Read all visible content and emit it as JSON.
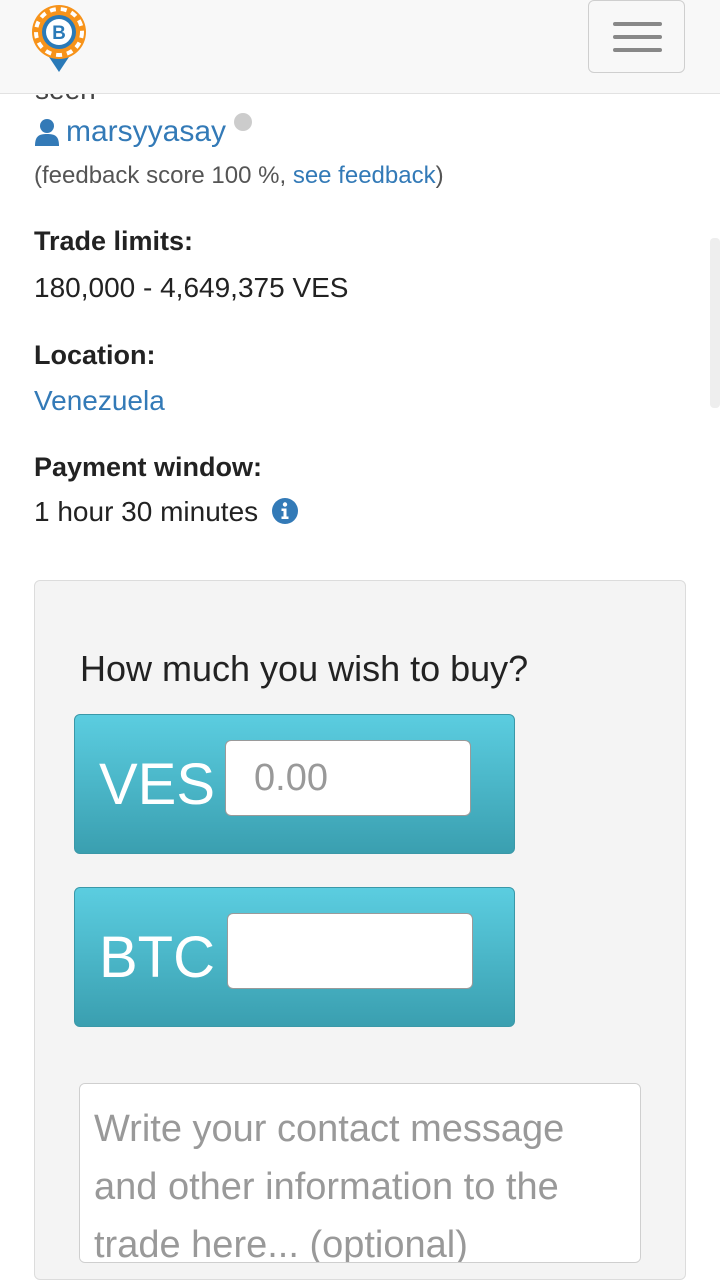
{
  "header": {
    "logo_icon": "bitcoin-map-pin-logo",
    "menu_icon": "hamburger-menu-icon"
  },
  "seller": {
    "cut_text": "seen",
    "name": "marsyyasay",
    "status": "offline",
    "feedback_prefix": "(feedback score 100 %, ",
    "feedback_link": "see feedback",
    "feedback_suffix": ")"
  },
  "details": {
    "trade_limits_label": "Trade limits:",
    "trade_limits_value": "180,000 - 4,649,375 VES",
    "location_label": "Location:",
    "location_value": "Venezuela",
    "payment_window_label": "Payment window:",
    "payment_window_value": "1 hour 30 minutes"
  },
  "trade_form": {
    "title": "How much you wish to buy?",
    "fiat_label": "VES",
    "fiat_placeholder": "0.00",
    "fiat_value": "",
    "crypto_label": "BTC",
    "crypto_value": "",
    "message_placeholder": "Write your contact message and other information to the trade here... (optional)"
  },
  "colors": {
    "link": "#337ab7",
    "bitcoin_orange": "#f7931a",
    "pin_blue": "#2a7ab8",
    "input_group_top": "#5bcde0",
    "input_group_bottom": "#3a9fb0"
  }
}
